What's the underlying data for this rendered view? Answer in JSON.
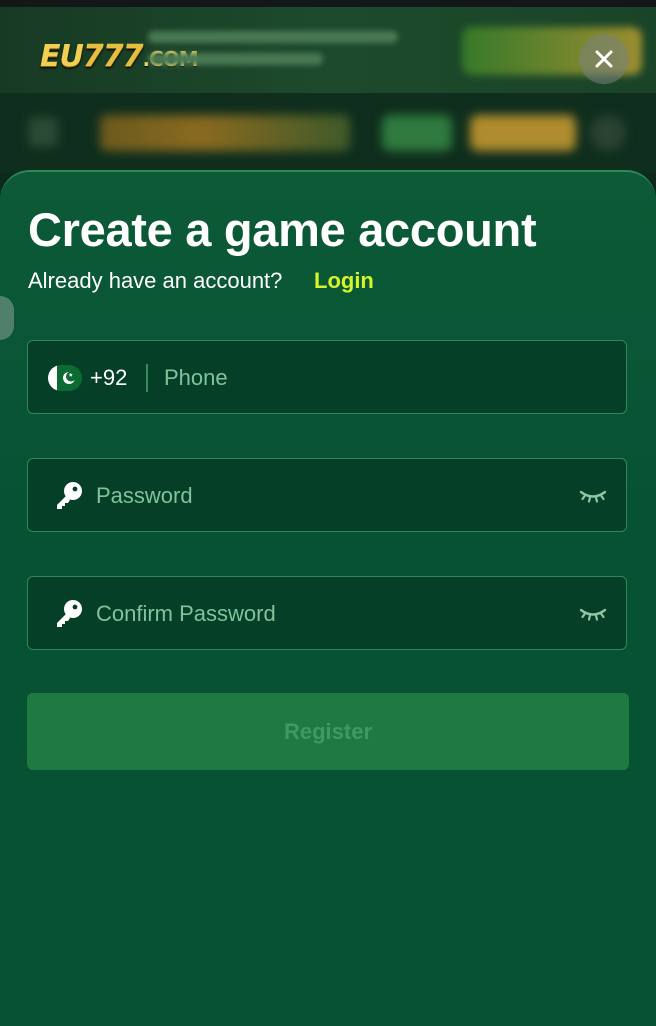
{
  "banner": {
    "logo_prefix": "EU",
    "logo_number": "777",
    "logo_suffix": ".COM",
    "close_icon": "close-icon"
  },
  "form": {
    "title": "Create a game account",
    "subtitle": "Already have an account?",
    "login_label": "Login",
    "phone": {
      "country_code": "+92",
      "flag_icon": "pakistan-flag-icon",
      "placeholder": "Phone",
      "value": ""
    },
    "password": {
      "placeholder": "Password",
      "value": "",
      "icon": "key-icon",
      "toggle_icon": "eye-closed-icon"
    },
    "confirm_password": {
      "placeholder": "Confirm Password",
      "value": "",
      "icon": "key-icon",
      "toggle_icon": "eye-closed-icon"
    },
    "register_label": "Register"
  },
  "colors": {
    "accent_link": "#d4f52a",
    "modal_bg": "#085234",
    "field_bg": "#053f27",
    "field_border": "#2b8a55",
    "register_bg": "#1f7a42"
  }
}
